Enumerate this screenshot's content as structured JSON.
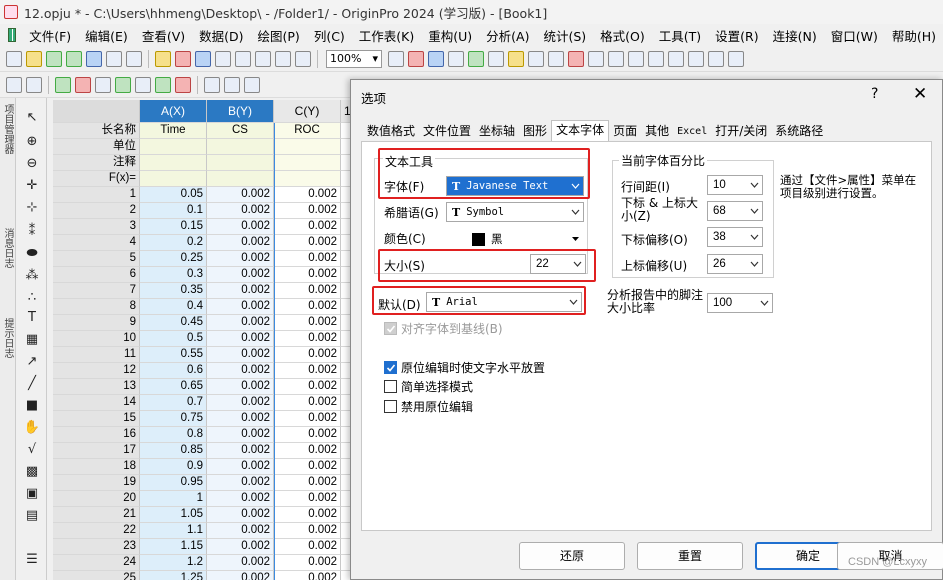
{
  "titlebar": {
    "title": "12.opju * - C:\\Users\\hhmeng\\Desktop\\ - /Folder1/ - OriginPro 2024 (学习版) - [Book1]"
  },
  "menubar": {
    "items": [
      "文件(F)",
      "编辑(E)",
      "查看(V)",
      "数据(D)",
      "绘图(P)",
      "列(C)",
      "工作表(K)",
      "重构(U)",
      "分析(A)",
      "统计(S)",
      "格式(O)",
      "工具(T)",
      "设置(R)",
      "连接(N)",
      "窗口(W)",
      "帮助(H)"
    ]
  },
  "toolbar": {
    "zoom": "100%"
  },
  "sheet": {
    "columns": [
      {
        "name": "A(X)",
        "long_name": "Time"
      },
      {
        "name": "B(Y)",
        "long_name": "CS"
      },
      {
        "name": "C(Y)",
        "long_name": "ROC"
      },
      {
        "name": "1"
      }
    ],
    "row_labels": {
      "long_name": "长名称",
      "units": "单位",
      "comments": "注释",
      "fx": "F(x)="
    },
    "rows": [
      [
        "1",
        "0.05",
        "0.002",
        "0.002"
      ],
      [
        "2",
        "0.1",
        "0.002",
        "0.002"
      ],
      [
        "3",
        "0.15",
        "0.002",
        "0.002"
      ],
      [
        "4",
        "0.2",
        "0.002",
        "0.002"
      ],
      [
        "5",
        "0.25",
        "0.002",
        "0.002"
      ],
      [
        "6",
        "0.3",
        "0.002",
        "0.002"
      ],
      [
        "7",
        "0.35",
        "0.002",
        "0.002"
      ],
      [
        "8",
        "0.4",
        "0.002",
        "0.002"
      ],
      [
        "9",
        "0.45",
        "0.002",
        "0.002"
      ],
      [
        "10",
        "0.5",
        "0.002",
        "0.002"
      ],
      [
        "11",
        "0.55",
        "0.002",
        "0.002"
      ],
      [
        "12",
        "0.6",
        "0.002",
        "0.002"
      ],
      [
        "13",
        "0.65",
        "0.002",
        "0.002"
      ],
      [
        "14",
        "0.7",
        "0.002",
        "0.002"
      ],
      [
        "15",
        "0.75",
        "0.002",
        "0.002"
      ],
      [
        "16",
        "0.8",
        "0.002",
        "0.002"
      ],
      [
        "17",
        "0.85",
        "0.002",
        "0.002"
      ],
      [
        "18",
        "0.9",
        "0.002",
        "0.002"
      ],
      [
        "19",
        "0.95",
        "0.002",
        "0.002"
      ],
      [
        "20",
        "1",
        "0.002",
        "0.002"
      ],
      [
        "21",
        "1.05",
        "0.002",
        "0.002"
      ],
      [
        "22",
        "1.1",
        "0.002",
        "0.002"
      ],
      [
        "23",
        "1.15",
        "0.002",
        "0.002"
      ],
      [
        "24",
        "1.2",
        "0.002",
        "0.002"
      ],
      [
        "25",
        "1.25",
        "0.002",
        "0.002"
      ]
    ]
  },
  "dialog": {
    "title": "选项",
    "help": "?",
    "close": "✕",
    "tabs": [
      "数值格式",
      "文件位置",
      "坐标轴",
      "图形",
      "文本字体",
      "页面",
      "其他",
      "Excel",
      "打开/关闭",
      "系统路径"
    ],
    "active_tab": "文本字体",
    "text_tool": {
      "group_label": "文本工具",
      "font_label": "字体(F)",
      "font_value": "Javanese Text",
      "greek_label": "希腊语(G)",
      "greek_value": "Symbol",
      "color_label": "颜色(C)",
      "color_value": "黑",
      "size_label": "大小(S)",
      "size_value": "22"
    },
    "default_label": "默认(D)",
    "default_value": "Arial",
    "align_baseline": "对齐字体到基线(B)",
    "percent": {
      "group_label": "当前字体百分比",
      "line_spacing_label": "行间距(I)",
      "line_spacing_value": "10",
      "sub_sup_label": "下标 & 上标大小(Z)",
      "sub_sup_value": "68",
      "sub_offset_label": "下标偏移(O)",
      "sub_offset_value": "38",
      "sup_offset_label": "上标偏移(U)",
      "sup_offset_value": "26"
    },
    "note": "通过【文件>属性】菜单在项目级别进行设置。",
    "report_label": "分析报告中的脚注大小比率",
    "report_value": "100",
    "checkboxes": [
      {
        "label": "原位编辑时使文字水平放置",
        "checked": true
      },
      {
        "label": "简单选择模式",
        "checked": false
      },
      {
        "label": "禁用原位编辑",
        "checked": false
      }
    ],
    "buttons": {
      "restore": "还原",
      "reset": "重置",
      "ok": "确定",
      "cancel": "取消"
    }
  },
  "watermark": "CSDN @Lcxyxy"
}
